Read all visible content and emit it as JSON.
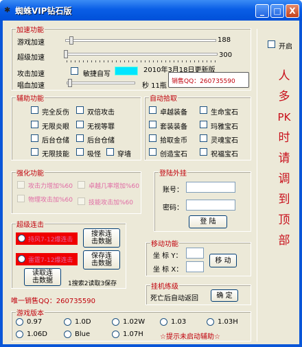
{
  "window": {
    "title": "蜘蛛VIP钻石版",
    "app_icon": "bug-icon",
    "min": "_",
    "max": "□",
    "close": "X"
  },
  "colors": {
    "accent_red": "#c0000b",
    "cyan_box": "#00e5ff",
    "red_panel": "#f00000",
    "pink_text": "#e06aa4"
  },
  "accel": {
    "legend": "加速功能",
    "game_label": "游戏加速",
    "game_max": "188",
    "super_label": "超级加速",
    "super_max": "300",
    "attack_label": "攻击加速",
    "hotkey_label": "敏捷自写",
    "date_text": "2010年3月18日更新版",
    "sing_label": "唱血加速",
    "sec_label": "秒 11瓶",
    "sales_qq": "销售QQ：260735590"
  },
  "aux": {
    "legend": "辅助功能",
    "items": [
      "完全反伤",
      "双倍攻击",
      "无限炎眼",
      "无视等罪",
      "后台仓储",
      "后台仓储",
      "无限技能",
      "吸怪",
      "穿墙"
    ]
  },
  "pickup": {
    "legend": "自动拾取",
    "items": [
      "卓越装备",
      "生命宝石",
      "套装装备",
      "玛雅宝石",
      "拾取金币",
      "灵魂宝石",
      "创造宝石",
      "祝福宝石"
    ]
  },
  "strong": {
    "legend": "强化功能",
    "items": [
      "攻击力增加%60",
      "卓越几率增加%60",
      "物理攻击加%60",
      "技能攻击加%60"
    ]
  },
  "login": {
    "legend": "登陆外挂",
    "account_label": "账号：",
    "password_label": "密码：",
    "login_btn": "登 陆"
  },
  "combo": {
    "legend": "超级连击",
    "opt1": "持风7-12爆连击",
    "opt2": "雷霆7-12爆连击",
    "search_btn": "搜索连击数据",
    "save_btn": "保存连击数据",
    "read_btn": "读取连击数据",
    "hint": "1搜索2读取3保存"
  },
  "move": {
    "legend": "移动功能",
    "x_label": "坐 标 Y：",
    "y_label": "坐 标 X：",
    "move_btn": "移 动"
  },
  "hang": {
    "legend": "挂机练级",
    "death_label": "死亡后自动返回",
    "ok_btn": "确 定"
  },
  "only_sales": "唯一销售QQ：260735590",
  "version": {
    "legend": "游戏版本",
    "items": [
      "0.97",
      "1.0D",
      "1.02W",
      "1.03",
      "1.03H",
      "1.06D",
      "Blue",
      "1.07H"
    ],
    "hint": "☆提示未启动辅助☆"
  },
  "right": {
    "open_label": "开启",
    "vertical_text": [
      "人",
      "多",
      "PK",
      "时",
      "请",
      "调",
      "到",
      "顶",
      "部"
    ]
  }
}
